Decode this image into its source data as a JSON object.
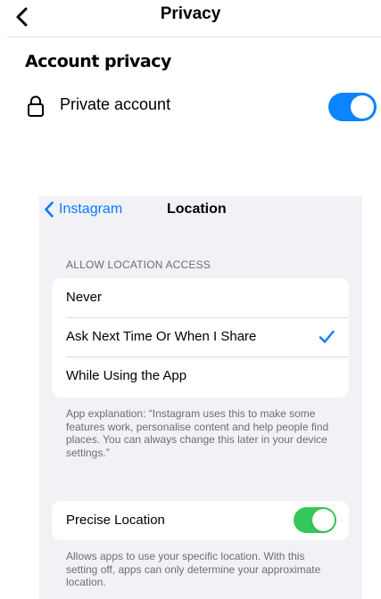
{
  "header": {
    "title": "Privacy",
    "back_icon": "chevron-left-icon"
  },
  "account_privacy": {
    "heading": "Account privacy",
    "private_account": {
      "label": "Private account",
      "icon": "lock-icon",
      "enabled": true
    }
  },
  "location_settings": {
    "back_label": "Instagram",
    "title": "Location",
    "allow_access_header": "ALLOW LOCATION ACCESS",
    "options": [
      {
        "label": "Never",
        "selected": false
      },
      {
        "label": "Ask Next Time Or When I Share",
        "selected": true
      },
      {
        "label": "While Using the App",
        "selected": false
      }
    ],
    "explanation": "App explanation: “Instagram uses this to make some features work, personalise content and help people find places. You can always change this later in your device settings.”",
    "precise_location": {
      "label": "Precise Location",
      "enabled": true
    },
    "precise_note": "Allows apps to use your specific location. With this setting off, apps can only determine your approximate location."
  },
  "colors": {
    "ios_blue": "#0a7aff",
    "toggle_blue": "#0a84ff",
    "toggle_green": "#34c759",
    "grouped_background": "#f1f1f6",
    "secondary_text": "#6d6d72"
  }
}
